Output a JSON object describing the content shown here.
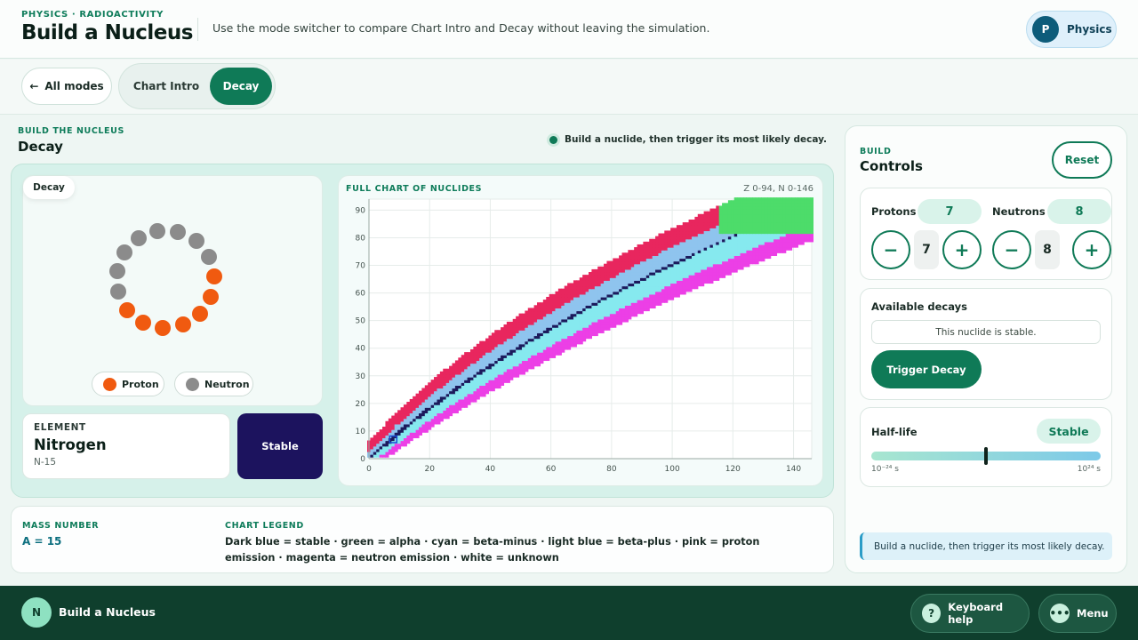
{
  "header": {
    "kicker": "PHYSICS · RADIOACTIVITY",
    "title": "Build a Nucleus",
    "description": "Use the mode switcher to compare Chart Intro and Decay without leaving the simulation.",
    "subject_avatar": "P",
    "subject_label": "Physics"
  },
  "mode_bar": {
    "back_label": "All modes",
    "back_icon": "arrow-left-icon",
    "tabs": [
      {
        "label": "Chart Intro",
        "active": false
      },
      {
        "label": "Decay",
        "active": true
      }
    ]
  },
  "section": {
    "kicker": "BUILD THE NUCLEUS",
    "title": "Decay",
    "hint": "Build a nuclide, then trigger its most likely decay."
  },
  "nucleus_view": {
    "badge": "Decay",
    "legend": [
      {
        "label": "Proton",
        "color": "#f05a10"
      },
      {
        "label": "Neutron",
        "color": "#8b8b8b"
      }
    ]
  },
  "element": {
    "kicker": "ELEMENT",
    "name": "Nitrogen",
    "isotope": "N-15",
    "stability": "Stable"
  },
  "chart": {
    "title": "FULL CHART OF NUCLIDES",
    "range": "Z 0-94, N 0-146"
  },
  "chart_data": {
    "type": "heatmap",
    "title": "FULL CHART OF NUCLIDES",
    "subtitle": "Z 0-94, N 0-146",
    "x_range": [
      0,
      146
    ],
    "y_range": [
      0,
      94
    ],
    "x_ticks": [
      0,
      20,
      40,
      60,
      80,
      100,
      120,
      140
    ],
    "y_ticks": [
      0,
      10,
      20,
      30,
      40,
      50,
      60,
      70,
      80,
      90
    ],
    "grid": true,
    "highlighted_nuclide": {
      "Z": 7,
      "N": 8
    },
    "categories": [
      {
        "name": "stable",
        "color": "#1c1a5c"
      },
      {
        "name": "alpha",
        "color": "#4ddc6a"
      },
      {
        "name": "beta-minus",
        "color": "#86e9ef"
      },
      {
        "name": "beta-plus",
        "color": "#8fc4ee"
      },
      {
        "name": "proton emission",
        "color": "#e8265e"
      },
      {
        "name": "neutron emission",
        "color": "#ec3fe6"
      },
      {
        "name": "unknown",
        "color": "#ffffff"
      }
    ]
  },
  "info": {
    "mass_kicker": "MASS NUMBER",
    "mass_value": "A = 15",
    "legend_kicker": "CHART LEGEND",
    "legend_text": "Dark blue = stable · green = alpha · cyan = beta-minus · light blue = beta-plus · pink = proton emission · magenta = neutron emission · white = unknown"
  },
  "controls": {
    "kicker": "BUILD",
    "title": "Controls",
    "reset_label": "Reset",
    "protons_label": "Protons",
    "protons_value": "7",
    "neutrons_label": "Neutrons",
    "neutrons_value": "8",
    "minus_label": "−",
    "plus_label": "+",
    "decays_heading": "Available decays",
    "decays_status": "This nuclide is stable.",
    "trigger_label": "Trigger Decay",
    "halflife_label": "Half-life",
    "halflife_value": "Stable",
    "halflife_min": "10⁻²⁴ s",
    "halflife_max": "10²⁴ s",
    "halflife_position": 0.5,
    "status_note": "Build a nuclide, then trigger its most likely decay."
  },
  "footer": {
    "avatar": "N",
    "title": "Build a Nucleus",
    "help_label": "Keyboard help",
    "help_icon": "?",
    "menu_label": "Menu",
    "menu_icon": "•••"
  }
}
